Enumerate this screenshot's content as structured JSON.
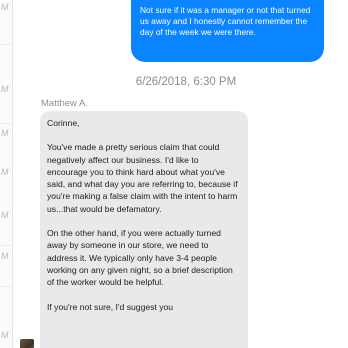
{
  "rail": {
    "letters": [
      "M",
      "M",
      "M",
      "M",
      "M",
      "M",
      "M"
    ]
  },
  "outgoing": {
    "text": "Not sure if it was a manager or not that turned us away and I honestly cannot remember the day of the week we were there."
  },
  "timestamp": "6/26/2018, 6:30 PM",
  "sender": "Matthew A.",
  "incoming": {
    "greeting": "Corinne,",
    "paragraph_1": "You've made a pretty serious claim that could negatively affect our business. I'd like to encourage you to think hard about what you've said, and what day you are referring to, because if you're making a false claim with the intent to harm us...that would be defamatory.",
    "paragraph_2": "On the other hand, if you were actually turned away by someone in our store, we need to address it. We typically only have 3-4 people working on any given night, so a brief description of the worker would be helpful.",
    "paragraph_3": "If you're not sure, I'd suggest you"
  }
}
